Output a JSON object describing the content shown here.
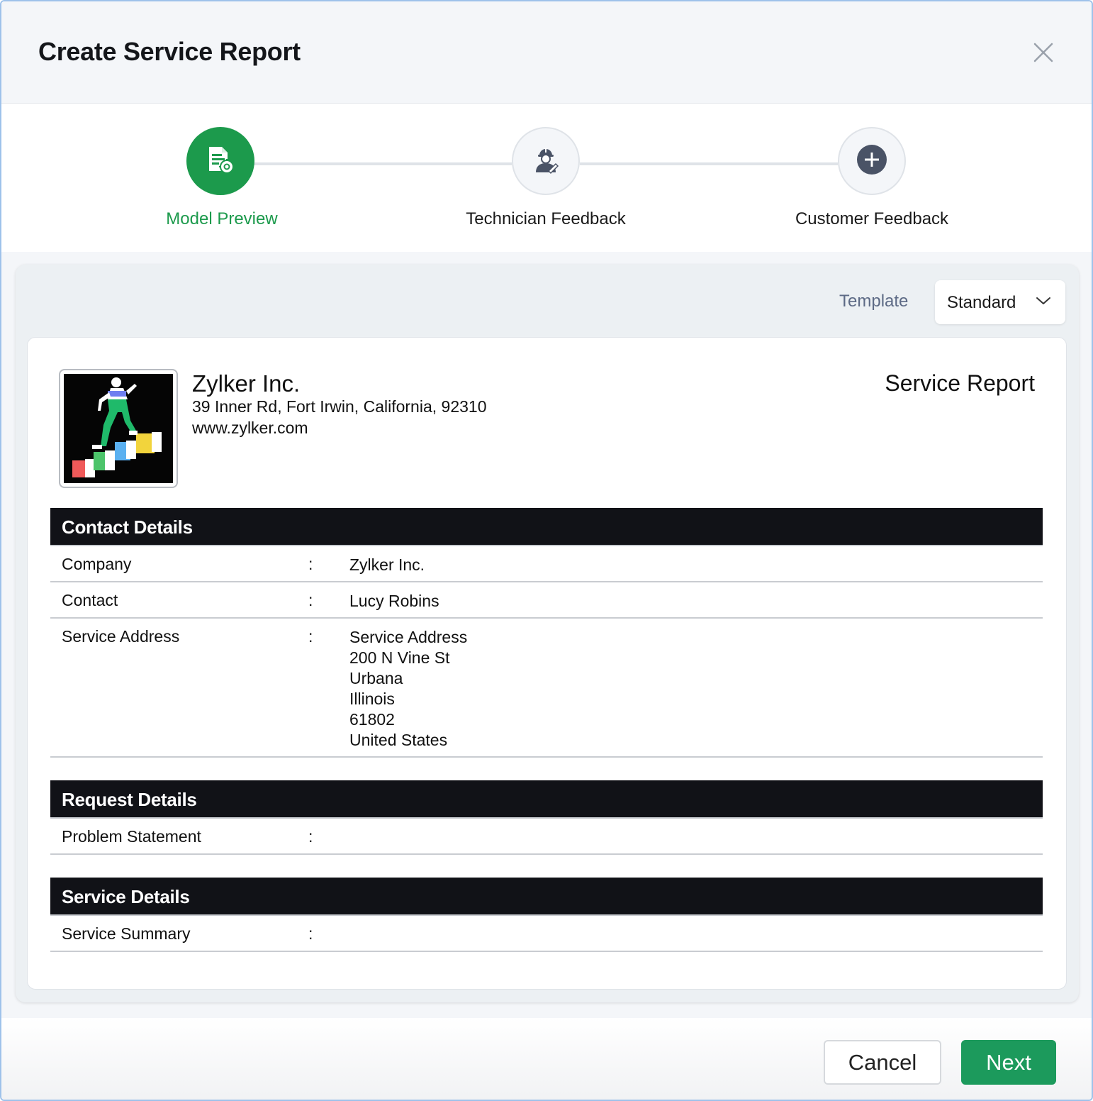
{
  "dialog": {
    "title": "Create Service Report"
  },
  "stepper": {
    "steps": [
      {
        "label": "Model Preview",
        "state": "active",
        "icon": "document-gear-icon"
      },
      {
        "label": "Technician Feedback",
        "state": "idle",
        "icon": "technician-icon"
      },
      {
        "label": "Customer Feedback",
        "state": "idle",
        "icon": "plus-circle-icon"
      }
    ]
  },
  "template": {
    "label": "Template",
    "selected": "Standard"
  },
  "report": {
    "company_name": "Zylker Inc.",
    "company_address": "39 Inner Rd, Fort Irwin, California, 92310",
    "company_website": "www.zylker.com",
    "title": "Service Report",
    "sections": {
      "contact": {
        "heading": "Contact Details",
        "rows": [
          {
            "key": "Company",
            "sep": ":",
            "value": "Zylker Inc."
          },
          {
            "key": "Contact",
            "sep": ":",
            "value": "Lucy Robins"
          },
          {
            "key": "Service Address",
            "sep": ":",
            "value_lines": [
              "Service Address",
              "200 N Vine St",
              "Urbana",
              "Illinois",
              "61802",
              "United States"
            ]
          }
        ]
      },
      "request": {
        "heading": "Request Details",
        "rows": [
          {
            "key": "Problem Statement",
            "sep": ":",
            "value": ""
          }
        ]
      },
      "service": {
        "heading": "Service Details",
        "rows": [
          {
            "key": "Service Summary",
            "sep": ":",
            "value": ""
          }
        ]
      }
    }
  },
  "footer": {
    "cancel_label": "Cancel",
    "next_label": "Next"
  },
  "colors": {
    "accent_green": "#1c9a4c",
    "section_header_bg": "#111217",
    "template_label": "#5d6a85"
  }
}
